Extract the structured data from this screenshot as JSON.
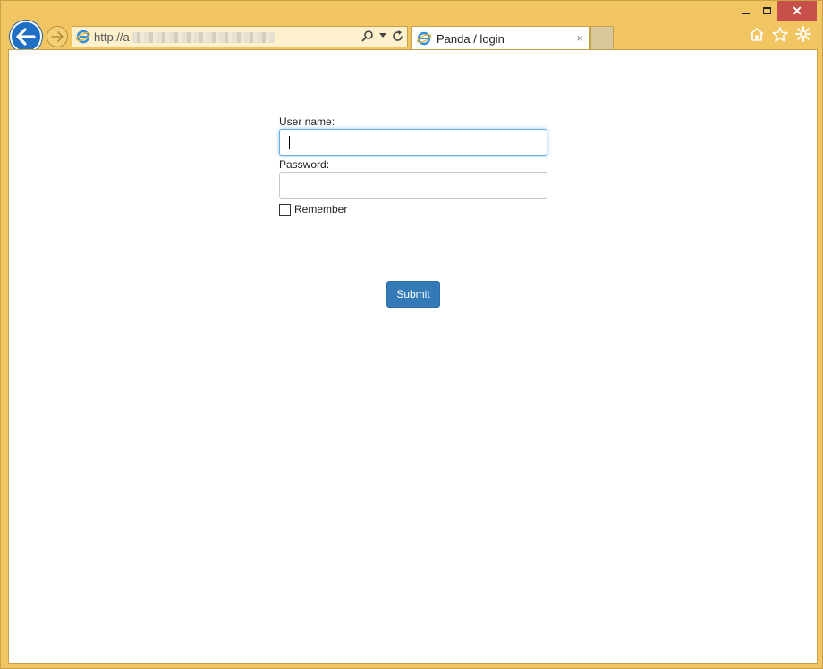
{
  "browser": {
    "address_prefix": "http://a",
    "tab_title": "Panda / login",
    "close_tab": "×",
    "window_close": "✕",
    "accent": "#f2c563",
    "back_button_color": "#1f6fc5"
  },
  "login": {
    "username_label": "User name:",
    "password_label": "Password:",
    "remember_label": "Remember",
    "remember_checked": false,
    "submit_label": "Submit",
    "submit_color": "#337ab7"
  }
}
